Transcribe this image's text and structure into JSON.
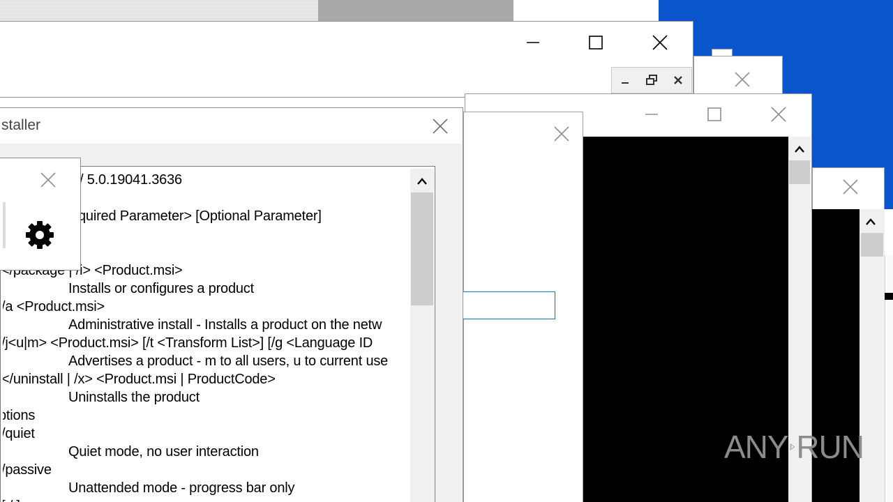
{
  "installer": {
    "title": "staller",
    "lines": [
      "/ 5.0.19041.3636",
      "quired Parameter> [Optional Parameter]",
      "</package | /i> <Product.msi>",
      "Installs or configures a product",
      "/a <Product.msi>",
      "Administrative install - Installs a product on the netw",
      "/j<u|m> <Product.msi> [/t <Transform List>] [/g <Language ID",
      "Advertises a product - m to all users, u to current use",
      "</uninstall | /x> <Product.msi | ProductCode>",
      "Uninstalls the product",
      "ptions",
      "/quiet",
      "Quiet mode, no user interaction",
      "/passive",
      "Unattended mode - progress bar only",
      "[ / ]"
    ]
  },
  "icons": {
    "minimize": "minimize-icon",
    "maximize": "maximize-icon",
    "restore": "restore-icon",
    "close": "close-icon",
    "settings": "gear-icon",
    "scroll_up": "chevron-up-icon"
  },
  "colors": {
    "desktop": "#0b55cc",
    "console": "#000000",
    "focus_border": "#0078d7"
  },
  "watermark": {
    "left": "ANY",
    "right": "RUN"
  }
}
